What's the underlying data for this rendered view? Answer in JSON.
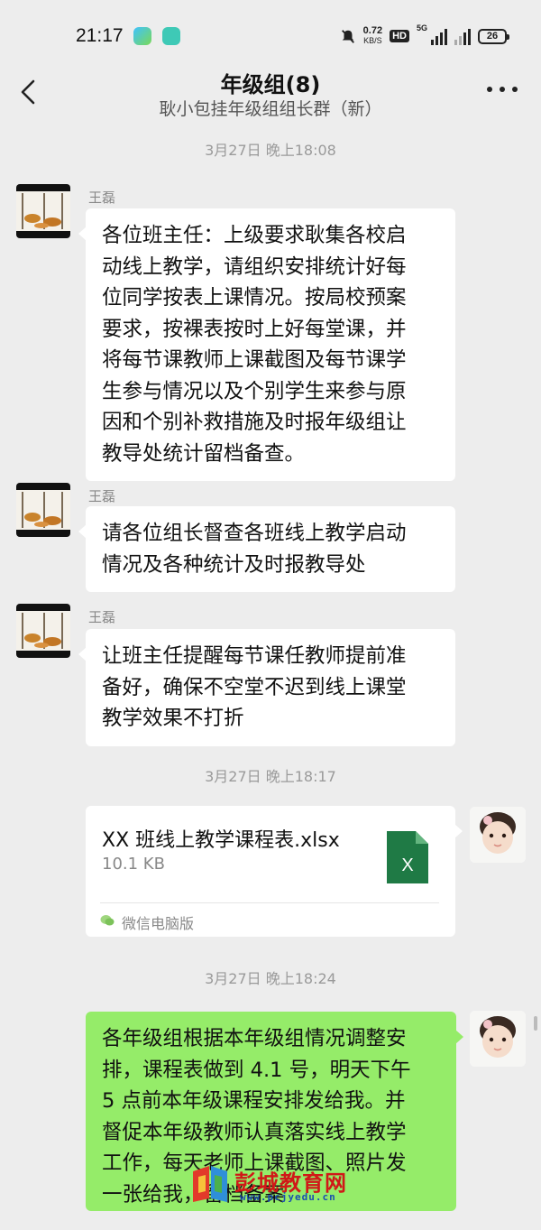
{
  "status_bar": {
    "time": "21:17",
    "net_speed": "0.72",
    "net_unit": "KB/S",
    "hd_badge": "HD",
    "signal_label": "5G",
    "battery": "26"
  },
  "nav": {
    "title": "年级组(8)",
    "subtitle": "耿小包挂年级组组长群（新）"
  },
  "messages": {
    "ts1": "3月27日 晚上18:08",
    "m1": {
      "sender": "王磊",
      "lines": [
        "各位班主任：上级要求耿集各校启",
        "动线上教学，请组织安排统计好每",
        "位同学按表上课情况。按局校预案",
        "要求，按裸表按时上好每堂课，并",
        "将每节课教师上课截图及每节课学",
        "生参与情况以及个别学生来参与原",
        "因和个别补救措施及时报年级组让",
        "教导处统计留档备查。"
      ]
    },
    "m2": {
      "sender": "王磊",
      "lines": [
        "请各位组长督查各班线上教学启动",
        "情况及各种统计及时报教导处"
      ]
    },
    "m3": {
      "sender": "王磊",
      "lines": [
        "让班主任提醒每节课任教师提前准",
        "备好，确保不空堂不迟到线上课堂",
        "教学效果不打折"
      ]
    },
    "ts2": "3月27日 晚上18:17",
    "file": {
      "name": "XX 班线上教学课程表.xlsx",
      "size": "10.1 KB",
      "icon_label": "X",
      "source": "微信电脑版"
    },
    "ts3": "3月27日 晚上18:24",
    "m4": {
      "lines": [
        "各年级组根据本年级组情况调整安",
        "排，课程表做到 4.1 号，明天下午",
        "5 点前本年级课程安排发给我。并",
        "督促本年级教师认真落实线上教学",
        "工作，每天老师上课截图、照片发",
        "一张给我，留档备案"
      ]
    }
  },
  "watermark": {
    "text": "彭城教育网",
    "url": "www.pcjyedu.cn"
  },
  "colors": {
    "background": "#ededed",
    "bubble_self": "#95ec69",
    "bubble_other": "#ffffff",
    "excel_green": "#1f7a45"
  },
  "icons": [
    "chevron-left-icon",
    "more-icon",
    "mute-icon",
    "excel-file-icon",
    "wechat-pc-icon"
  ]
}
